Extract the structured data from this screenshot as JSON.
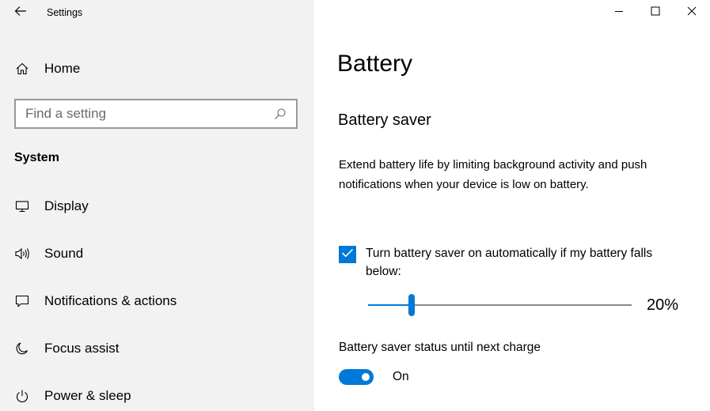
{
  "app": {
    "title": "Settings",
    "back_icon": "arrow-left-icon"
  },
  "caption": {
    "minimize_icon": "minimize-icon",
    "maximize_icon": "maximize-icon",
    "close_icon": "close-icon"
  },
  "sidebar": {
    "home": {
      "label": "Home",
      "icon": "home-icon"
    },
    "search": {
      "placeholder": "Find a setting",
      "value": "",
      "icon": "search-icon"
    },
    "section_header": "System",
    "items": [
      {
        "label": "Display",
        "icon": "display-icon"
      },
      {
        "label": "Sound",
        "icon": "speaker-icon"
      },
      {
        "label": "Notifications & actions",
        "icon": "notification-icon"
      },
      {
        "label": "Focus assist",
        "icon": "moon-icon"
      },
      {
        "label": "Power & sleep",
        "icon": "power-icon"
      }
    ]
  },
  "main": {
    "title": "Battery",
    "section_title": "Battery saver",
    "description": "Extend battery life by limiting background activity and push notifications when your device is low on battery.",
    "auto_saver": {
      "checked": true,
      "label": "Turn battery saver on automatically if my battery falls below:"
    },
    "threshold": {
      "value": 20,
      "min": 0,
      "max": 100,
      "display": "20%"
    },
    "status": {
      "label": "Battery saver status until next charge",
      "toggle_on": true,
      "toggle_text": "On"
    }
  },
  "colors": {
    "accent": "#0078d7",
    "sidebar_bg": "#f2f2f2",
    "content_bg": "#ffffff"
  }
}
